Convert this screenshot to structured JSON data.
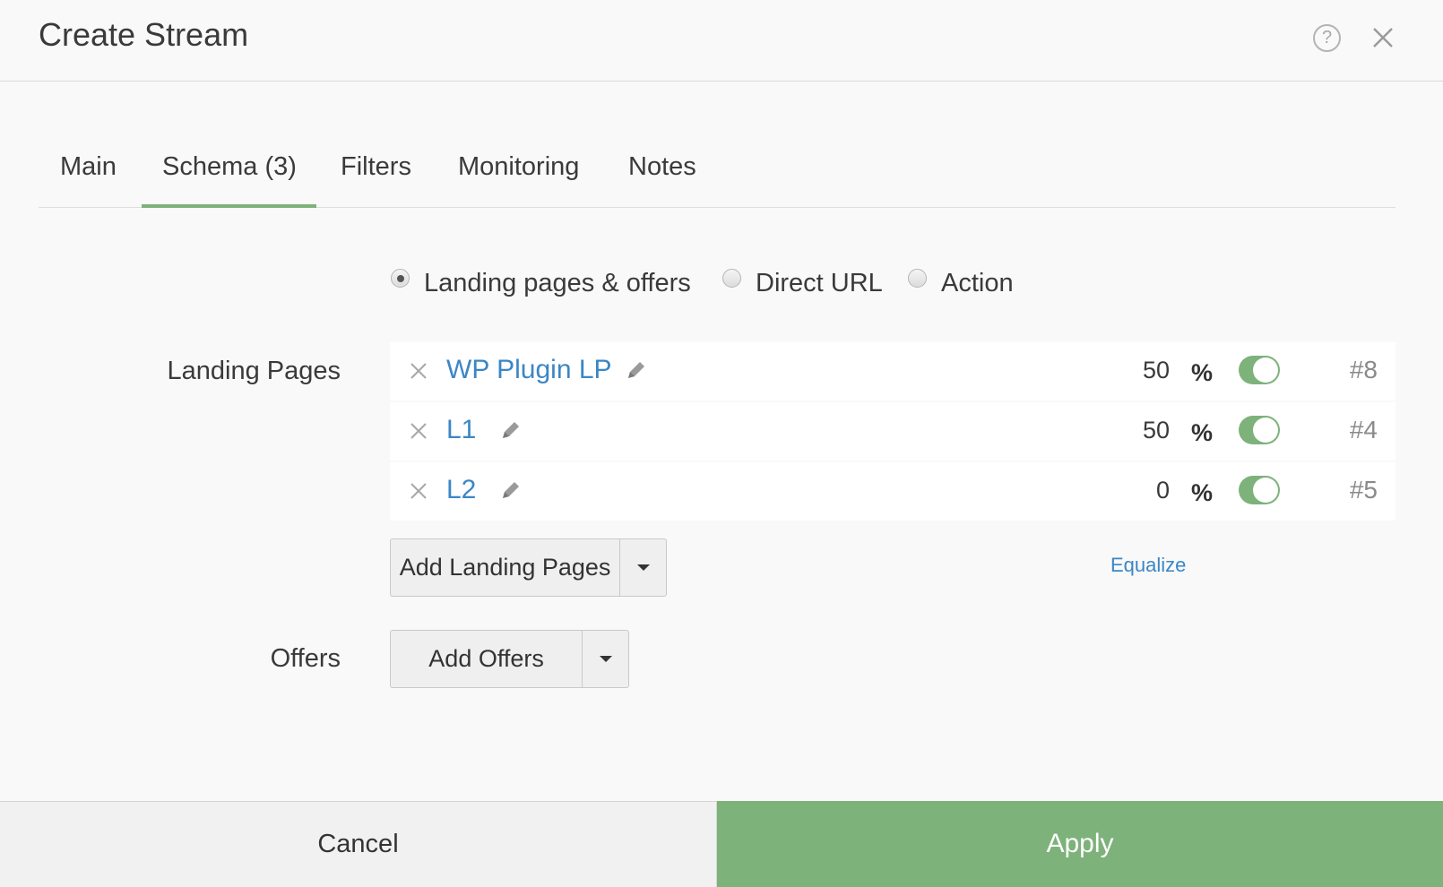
{
  "dialog": {
    "title": "Create Stream",
    "help_icon": "question-circle-icon",
    "close_icon": "close-icon"
  },
  "tabs": [
    {
      "label": "Main",
      "active": false
    },
    {
      "label": "Schema (3)",
      "active": true
    },
    {
      "label": "Filters",
      "active": false
    },
    {
      "label": "Monitoring",
      "active": false
    },
    {
      "label": "Notes",
      "active": false
    }
  ],
  "schema": {
    "options": [
      {
        "label": "Landing pages & offers",
        "checked": true
      },
      {
        "label": "Direct URL",
        "checked": false
      },
      {
        "label": "Action",
        "checked": false
      }
    ]
  },
  "landing_pages": {
    "label": "Landing Pages",
    "items": [
      {
        "name": "WP Plugin LP",
        "weight": "50",
        "percent_sign": "%",
        "enabled": true,
        "id": "#8"
      },
      {
        "name": "L1",
        "weight": "50",
        "percent_sign": "%",
        "enabled": true,
        "id": "#4"
      },
      {
        "name": "L2",
        "weight": "0",
        "percent_sign": "%",
        "enabled": true,
        "id": "#5"
      }
    ],
    "add_label": "Add Landing Pages",
    "equalize_label": "Equalize"
  },
  "offers": {
    "label": "Offers",
    "add_label": "Add Offers"
  },
  "footer": {
    "cancel_label": "Cancel",
    "apply_label": "Apply"
  },
  "colors": {
    "accent_green": "#7db27a",
    "link_blue": "#3b86c6"
  }
}
